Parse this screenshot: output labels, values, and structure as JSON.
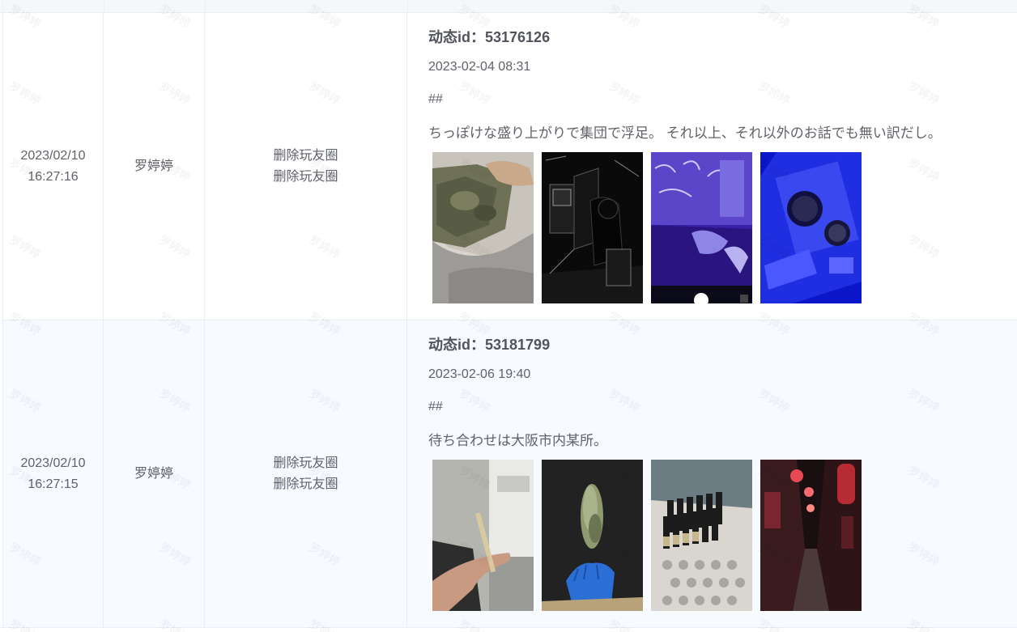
{
  "watermark_text": "罗婷婷",
  "rows": [
    {
      "time_date": "2023/02/10",
      "time_clock": "16:27:16",
      "user": "罗婷婷",
      "action_1": "删除玩友圈",
      "action_2": "删除玩友圈",
      "post": {
        "id_label": "动态id：53176126",
        "date": "2023-02-04 08:31",
        "tags": "##",
        "text": "ちっぽけな盛り上がりで集団で浮足。 それ以上、それ以外のお話でも無い訳だし。",
        "images": [
          "photo-bag",
          "photo-dark-arcade",
          "photo-purple-room",
          "photo-blue-table"
        ]
      }
    },
    {
      "time_date": "2023/02/10",
      "time_clock": "16:27:15",
      "user": "罗婷婷",
      "action_1": "删除玩友圈",
      "action_2": "删除玩友圈",
      "post": {
        "id_label": "动态id：53181799",
        "date": "2023-02-06 19:40",
        "tags": "##",
        "text": "待ち合わせは大阪市内某所。",
        "images": [
          "photo-hand-joint",
          "photo-blue-glove",
          "photo-vials-tray",
          "photo-red-alley"
        ]
      }
    }
  ],
  "colors": {
    "border": "#ebeef5",
    "row_alt_bg": "#f7fafe",
    "text": "#5f6268"
  }
}
